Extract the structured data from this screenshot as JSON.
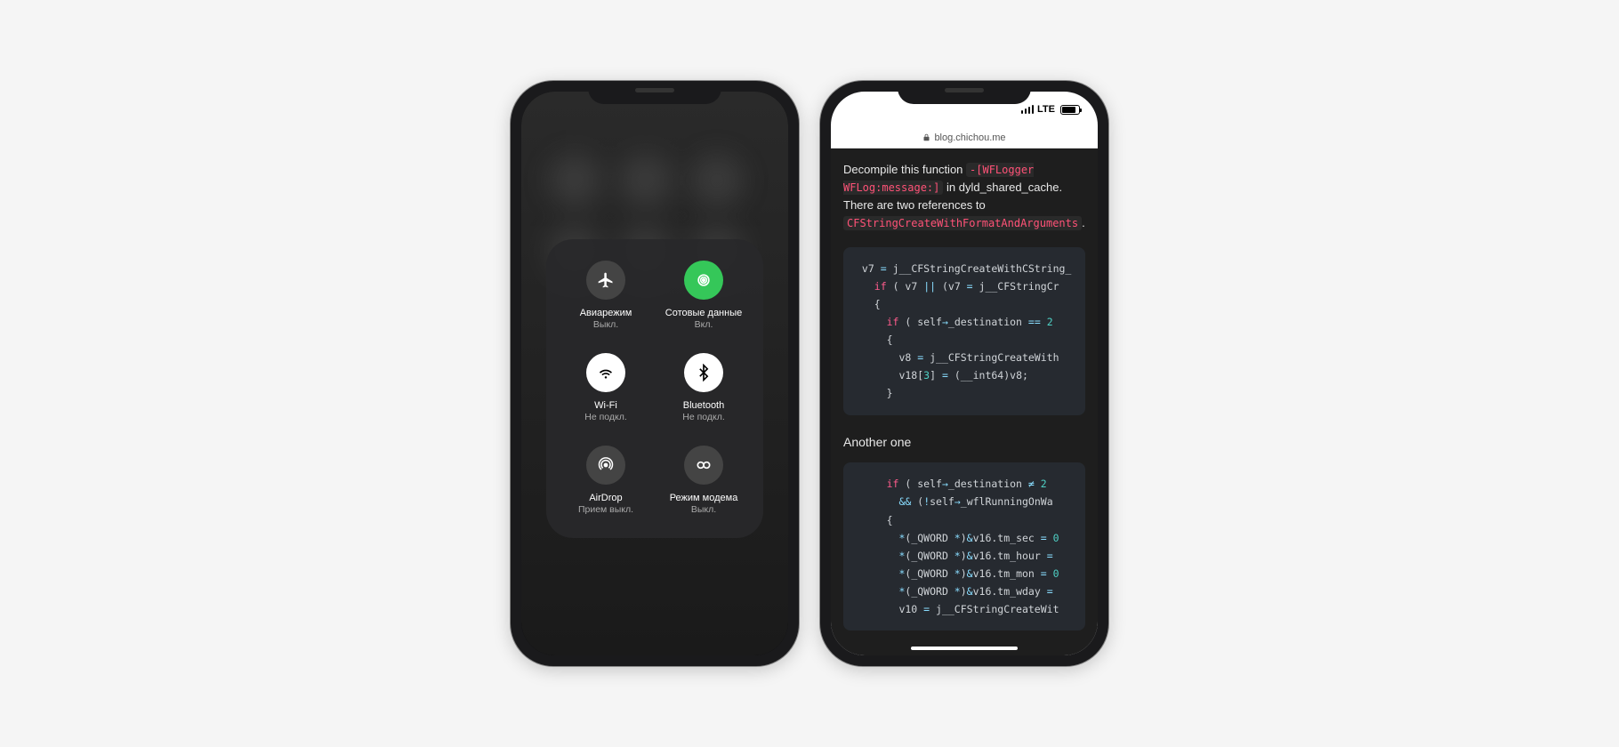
{
  "phone1": {
    "controlCenter": {
      "items": [
        {
          "name": "airplane",
          "title": "Авиарежим",
          "sub": "Выкл.",
          "state": "off"
        },
        {
          "name": "cellular",
          "title": "Сотовые данные",
          "sub": "Вкл.",
          "state": "on-green"
        },
        {
          "name": "wifi",
          "title": "Wi-Fi",
          "sub": "Не подкл.",
          "state": "on-white"
        },
        {
          "name": "bluetooth",
          "title": "Bluetooth",
          "sub": "Не подкл.",
          "state": "on-white"
        },
        {
          "name": "airdrop",
          "title": "AirDrop",
          "sub": "Прием выкл.",
          "state": "off"
        },
        {
          "name": "hotspot",
          "title": "Режим модема",
          "sub": "Выкл.",
          "state": "off"
        }
      ]
    }
  },
  "phone2": {
    "status": {
      "network": "LTE"
    },
    "url": "blog.chichou.me",
    "article": {
      "p1_pre": "Decompile this function ",
      "code1": "-[WFLogger WFLog:message:]",
      "p1_mid": " in dyld_shared_cache. There are two references to ",
      "code2": "CFStringCreateWithFormatAndArguments",
      "p1_end": ".",
      "subhead": "Another one"
    },
    "codeblock1": {
      "l1_a": " v7 ",
      "l1_b": "=",
      "l1_c": " j__CFStringCreateWithCString_",
      "l2_a": "   ",
      "l2_if": "if",
      "l2_b": " ( v7 ",
      "l2_c": "||",
      "l2_d": " (v7 ",
      "l2_e": "=",
      "l2_f": " j__CFStringCr",
      "l3": "   {",
      "l4_a": "     ",
      "l4_if": "if",
      "l4_b": " ( self",
      "l4_arrow": "→",
      "l4_c": "_destination ",
      "l4_eq": "==",
      "l4_sp": " ",
      "l4_num": "2",
      "l5": "     {",
      "l6_a": "       v8 ",
      "l6_eq": "=",
      "l6_b": " j__CFStringCreateWith",
      "l7_a": "       v18[",
      "l7_n": "3",
      "l7_b": "] ",
      "l7_eq": "=",
      "l7_c": " (__int64)v8;",
      "l8": "     }"
    },
    "codeblock2": {
      "l1_a": "     ",
      "l1_if": "if",
      "l1_b": " ( self",
      "l1_ar": "→",
      "l1_c": "_destination ",
      "l1_ne": "≠",
      "l1_sp": " ",
      "l1_n": "2",
      "l2_a": "       ",
      "l2_and": "&&",
      "l2_b": " (",
      "l2_not": "!",
      "l2_c": "self",
      "l2_ar": "→",
      "l2_d": "_wflRunningOnWa",
      "l3": "     {",
      "l4_a": "       ",
      "l4_s": "*",
      "l4_b": "(_QWORD ",
      "l4_s2": "*",
      "l4_c": ")",
      "l4_amp": "&",
      "l4_d": "v16.tm_sec ",
      "l4_eq": "=",
      "l4_sp": " ",
      "l4_n": "0",
      "l5_a": "       ",
      "l5_s": "*",
      "l5_b": "(_QWORD ",
      "l5_s2": "*",
      "l5_c": ")",
      "l5_amp": "&",
      "l5_d": "v16.tm_hour ",
      "l5_eq": "=",
      "l6_a": "       ",
      "l6_s": "*",
      "l6_b": "(_QWORD ",
      "l6_s2": "*",
      "l6_c": ")",
      "l6_amp": "&",
      "l6_d": "v16.tm_mon ",
      "l6_eq": "=",
      "l6_sp": " ",
      "l6_n": "0",
      "l7_a": "       ",
      "l7_s": "*",
      "l7_b": "(_QWORD ",
      "l7_s2": "*",
      "l7_c": ")",
      "l7_amp": "&",
      "l7_d": "v16.tm_wday ",
      "l7_eq": "=",
      "l8_a": "       v10 ",
      "l8_eq": "=",
      "l8_b": " j__CFStringCreateWit"
    }
  },
  "colors": {
    "green": "#35c759",
    "code_bg": "#262a30",
    "inline_code_fg": "#ff5277",
    "keyword": "#ff5c8d",
    "number": "#4fd1c5",
    "operator": "#89ddff"
  }
}
